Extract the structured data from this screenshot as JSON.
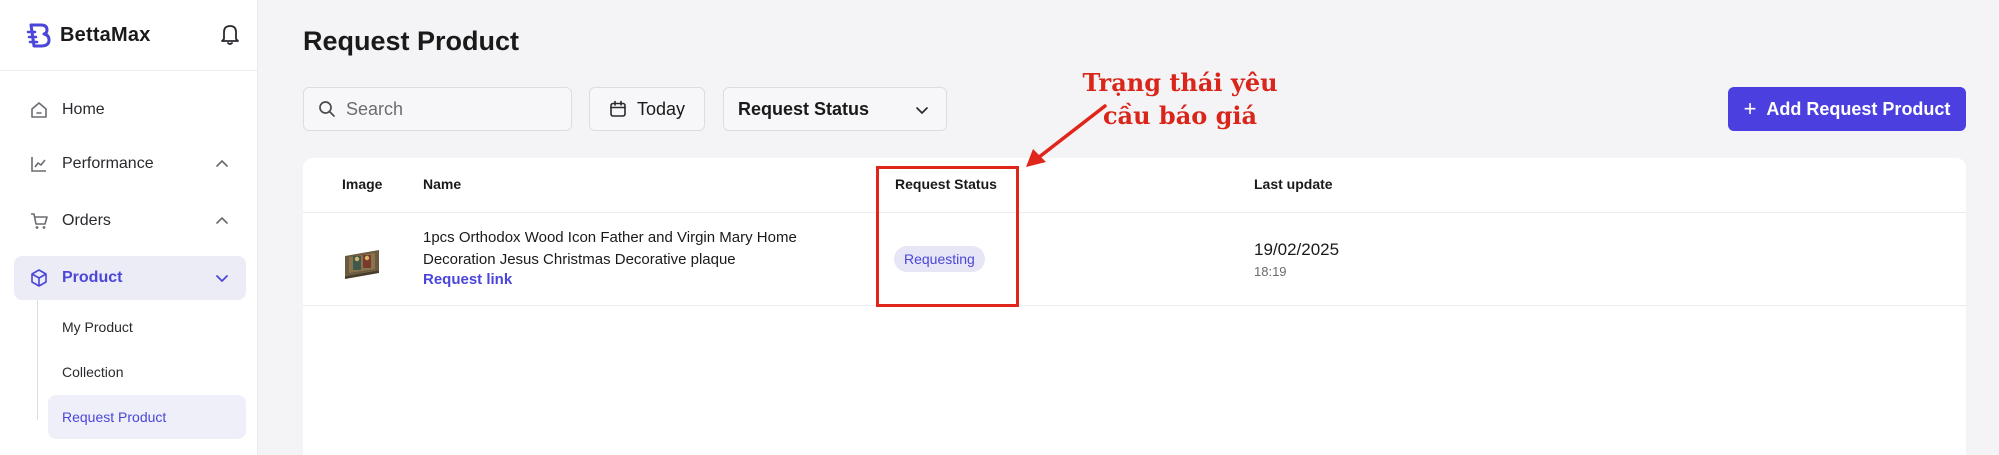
{
  "app": {
    "brand": "BettaMax",
    "accent": "#4b46d9",
    "brand_icon": "bettamax-logo-icon",
    "notification_icon": "bell-icon"
  },
  "sidebar": {
    "items": [
      {
        "label": "Home",
        "icon": "home-icon"
      },
      {
        "label": "Performance",
        "icon": "chart-icon",
        "expandable": true
      },
      {
        "label": "Orders",
        "icon": "cart-icon",
        "expandable": true
      },
      {
        "label": "Product",
        "icon": "box-icon",
        "expandable": true,
        "active": true
      }
    ],
    "subitems": [
      {
        "label": "My Product"
      },
      {
        "label": "Collection"
      },
      {
        "label": "Request Product",
        "active": true
      }
    ]
  },
  "main": {
    "title": "Request Product",
    "search_placeholder": "Search",
    "date_filter_label": "Today",
    "status_filter_label": "Request Status",
    "add_button_label": "Add Request Product"
  },
  "table": {
    "headers": [
      "Image",
      "Name",
      "Request Status",
      "Last update"
    ],
    "rows": [
      {
        "name_line1": "1pcs Orthodox Wood Icon Father and Virgin Mary Home",
        "name_line2": "Decoration Jesus Christmas Decorative plaque",
        "link": "Request link",
        "status": "Requesting",
        "date": "19/02/2025",
        "time": "18:19"
      }
    ]
  },
  "annotation": {
    "line1": "Trạng thái yêu",
    "line2": "cầu báo giá",
    "color": "#e0261b"
  }
}
